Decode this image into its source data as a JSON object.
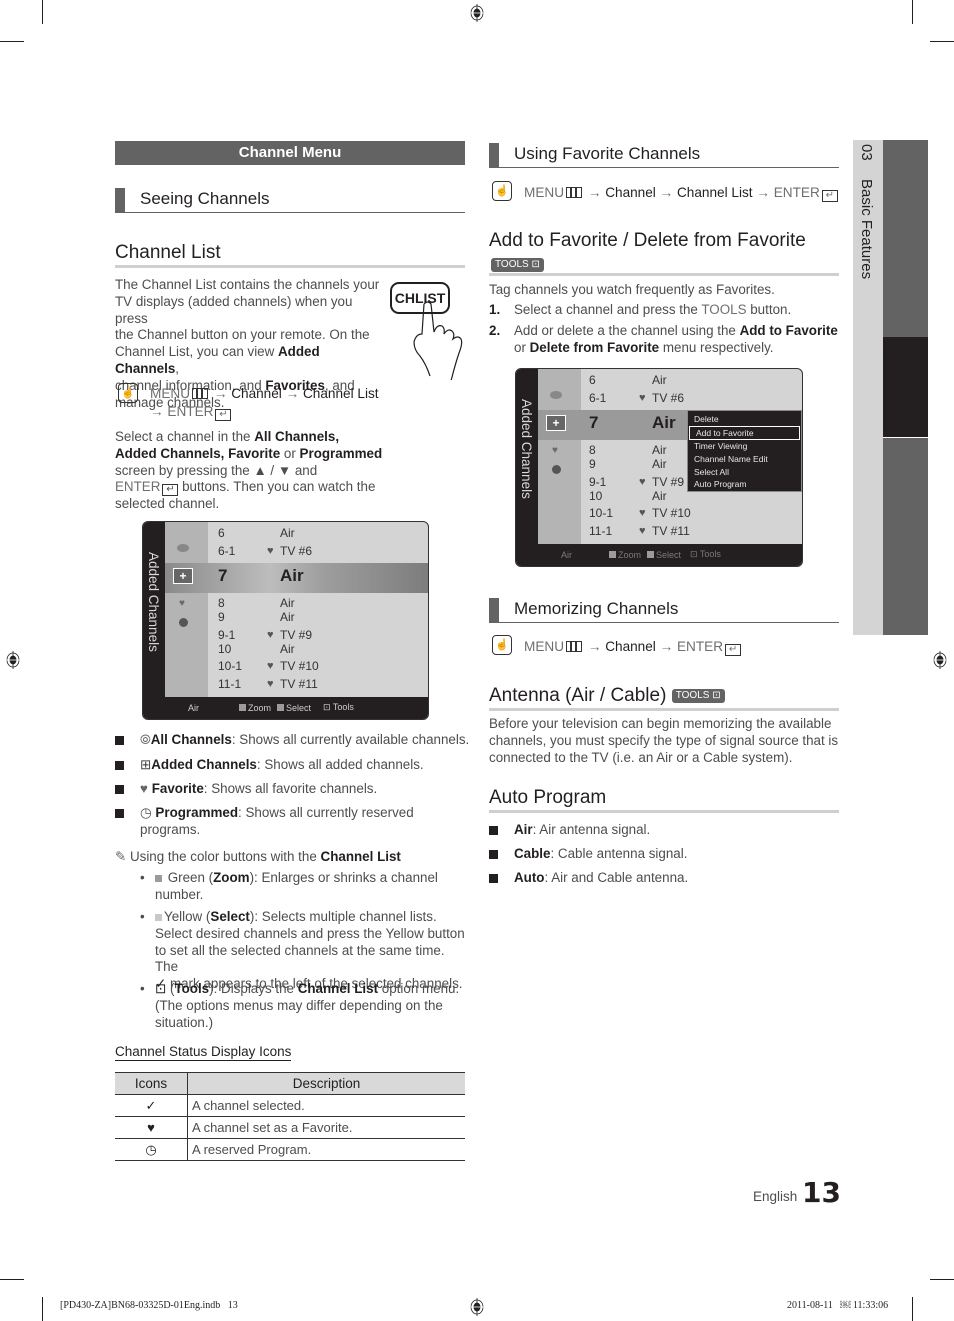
{
  "header": {
    "menu_bar": "Channel Menu",
    "section_seeing": "Seeing Channels"
  },
  "left": {
    "channel_list_title": "Channel List",
    "intro_lines": [
      "The Channel List contains the channels your",
      "TV displays (added channels) when you press",
      "the Channel button on your remote. On the"
    ],
    "intro_line4_a": "Channel List, you can view ",
    "intro_line4_b": "Added Channels",
    "intro_line4_c": ",",
    "intro_line5_a": "channel information, and ",
    "intro_line5_b": "Favorites",
    "intro_line5_c": ", and",
    "intro_line6": "manage channels.",
    "chlist_button": "CHLIST",
    "menu_path": {
      "menu": "MENU",
      "arrow": "→",
      "channel": "Channel",
      "channel_list": "Channel List",
      "enter": "ENTER"
    },
    "select_para": {
      "l1a": "Select a channel in the ",
      "l1b": "All Channels,",
      "l2a": "Added Channels, Favorite",
      "l2b": " or ",
      "l2c": "Programmed",
      "l3": "screen by pressing the ▲ / ▼ and",
      "l4a": "ENTER",
      "l4b": " buttons. Then you can watch the",
      "l5": "selected channel."
    },
    "tv": {
      "side_label": "Added Channels",
      "rows": [
        {
          "num": "6",
          "fav": false,
          "name": "Air"
        },
        {
          "num": "6-1",
          "fav": true,
          "name": "TV #6"
        },
        {
          "num": "7",
          "fav": false,
          "name": "Air",
          "selected": true
        },
        {
          "num": "8",
          "fav": false,
          "name": "Air"
        },
        {
          "num": "9",
          "fav": false,
          "name": "Air"
        },
        {
          "num": "9-1",
          "fav": true,
          "name": "TV #9"
        },
        {
          "num": "10",
          "fav": false,
          "name": "Air"
        },
        {
          "num": "10-1",
          "fav": true,
          "name": "TV #10"
        },
        {
          "num": "11-1",
          "fav": true,
          "name": "TV #11"
        }
      ],
      "footer": {
        "source": "Air",
        "zoom": "Zoom",
        "select": "Select",
        "tools": "Tools"
      }
    },
    "bullets": [
      {
        "bold": "All Channels",
        "text": ": Shows all currently available channels.",
        "icon": "all-channels-icon"
      },
      {
        "bold": "Added Channels",
        "text": ": Shows all added channels.",
        "icon": "added-channels-icon"
      },
      {
        "bold": "Favorite",
        "text": ": Shows all favorite channels.",
        "icon": "favorite-icon"
      },
      {
        "bold": "Programmed",
        "text": ": Shows all currently reserved",
        "text2": "programs.",
        "icon": "programmed-icon"
      }
    ],
    "note": {
      "lead_a": "Using the color buttons with the ",
      "lead_b": "Channel List",
      "items": [
        {
          "l1a": " Green (",
          "l1b": "Zoom",
          "l1c": "): Enlarges or shrinks a channel",
          "l2": "number."
        },
        {
          "l1a": "Yellow (",
          "l1b": "Select",
          "l1c": "): Selects multiple channel lists.",
          "l2": "Select desired channels and press the Yellow button",
          "l3": "to set all the selected channels at the same time. The",
          "l4": " mark appears to the left of the selected channels."
        },
        {
          "l1a": " (",
          "l1b": "Tools",
          "l1c": "): Displays the ",
          "l1d": "Channel List",
          "l1e": " option menu.",
          "l2": "(The options menus may differ depending on the",
          "l3": "situation.)"
        }
      ]
    },
    "status_title": "Channel Status Display Icons",
    "status_table": {
      "headers": [
        "Icons",
        "Description"
      ],
      "rows": [
        {
          "icon": "✓",
          "desc": "A channel selected."
        },
        {
          "icon": "♥",
          "desc": "A channel set as a Favorite."
        },
        {
          "icon": "◷",
          "desc": "A reserved Program."
        }
      ]
    }
  },
  "right": {
    "using_fav_title": "Using Favorite Channels",
    "fav_menu_path": {
      "menu": "MENU",
      "arrow": "→",
      "channel": "Channel",
      "channel_list": "Channel List",
      "enter": "ENTER"
    },
    "add_fav_title": "Add to Favorite / Delete from Favorite",
    "tools_badge": "TOOLS",
    "tag_para": "Tag channels you watch frequently as Favorites.",
    "steps": [
      {
        "num": "1.",
        "a": "Select a channel and press the ",
        "b": "TOOLS",
        "c": " button."
      },
      {
        "num": "2.",
        "a": "Add or delete a the channel using the ",
        "b": "Add to Favorite",
        "l2a": "or ",
        "l2b": "Delete from Favorite",
        "l2c": " menu respectively."
      }
    ],
    "tv": {
      "side_label": "Added Channels",
      "rows": [
        {
          "num": "6",
          "fav": false,
          "name": "Air"
        },
        {
          "num": "6-1",
          "fav": true,
          "name": "TV #6"
        },
        {
          "num": "7",
          "fav": false,
          "name": "Air",
          "selected": true
        },
        {
          "num": "8",
          "fav": false,
          "name": "Air"
        },
        {
          "num": "9",
          "fav": false,
          "name": "Air"
        },
        {
          "num": "9-1",
          "fav": true,
          "name": "TV #9"
        },
        {
          "num": "10",
          "fav": false,
          "name": "Air"
        },
        {
          "num": "10-1",
          "fav": true,
          "name": "TV #10"
        },
        {
          "num": "11-1",
          "fav": true,
          "name": "TV #11"
        }
      ],
      "popup_items": [
        "Delete",
        "Add to Favorite",
        "Timer Viewing",
        "Channel Name Edit",
        "Select All",
        "Auto Program"
      ],
      "popup_selected": "Add to Favorite",
      "footer": {
        "source": "Air",
        "zoom": "Zoom",
        "select": "Select",
        "tools": "Tools"
      }
    },
    "memorizing_title": "Memorizing Channels",
    "mem_menu_path": {
      "menu": "MENU",
      "arrow": "→",
      "channel": "Channel",
      "enter": "ENTER"
    },
    "antenna_title": "Antenna (Air / Cable)",
    "antenna_para": [
      "Before your television can begin memorizing the available",
      "channels, you must specify the type of signal source that is",
      "connected to the TV (i.e. an Air or a Cable system)."
    ],
    "auto_program_title": "Auto Program",
    "auto_items": [
      {
        "bold": "Air",
        "text": ": Air antenna signal."
      },
      {
        "bold": "Cable",
        "text": ": Cable antenna signal."
      },
      {
        "bold": "Auto",
        "text": ": Air and Cable antenna."
      }
    ]
  },
  "side_tab": {
    "chapter": "03",
    "title": "Basic Features"
  },
  "footer": {
    "language": "English",
    "page_number": "13",
    "file_slug": "[PD430-ZA]BN68-03325D-01Eng.indb   13",
    "print_stamp": "2011-08-11   ￼ 11:33:06"
  },
  "colors": {
    "header_gray": "#636363",
    "rule_gray": "#cfcfcf",
    "dark": "#231f20"
  }
}
